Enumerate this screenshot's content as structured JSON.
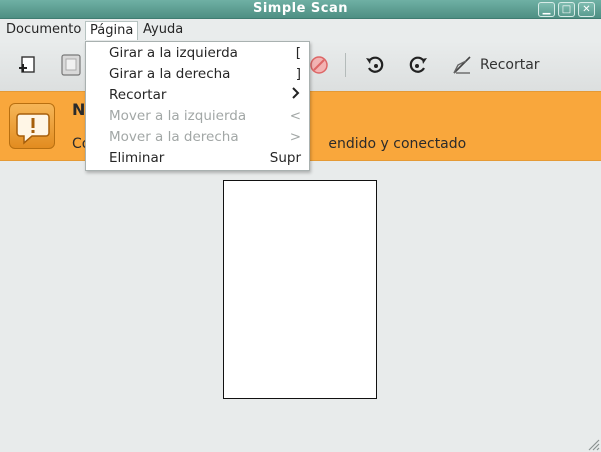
{
  "window": {
    "title": "Simple Scan"
  },
  "menubar": {
    "items": [
      "Documento",
      "Página",
      "Ayuda"
    ]
  },
  "toolbar": {
    "crop_label": "Recortar"
  },
  "infobar": {
    "title": "N                          ner",
    "text_start": "Co",
    "text_end": "endido y conectado"
  },
  "page_menu": {
    "items": [
      {
        "label": "Girar a la izquierda",
        "accel": "[",
        "enabled": true
      },
      {
        "label": "Girar a la derecha",
        "accel": "]",
        "enabled": true
      },
      {
        "label": "Recortar",
        "accel": "",
        "submenu": true,
        "enabled": true
      },
      {
        "label": "Mover a la izquierda",
        "accel": "<",
        "enabled": false
      },
      {
        "label": "Mover a la derecha",
        "accel": ">",
        "enabled": false
      },
      {
        "label": "Eliminar",
        "accel": "Supr",
        "enabled": true
      }
    ]
  },
  "icons": {
    "new_page": "new-page-icon",
    "scan": "scan-icon",
    "stop": "stop-icon",
    "rotate_left": "rotate-left-icon",
    "rotate_right": "rotate-right-icon",
    "crop": "crop-icon",
    "info": "info-icon",
    "submenu": "chevron-right-icon"
  },
  "colors": {
    "titlebar": "#5a9c90",
    "infobar": "#f9a73c"
  }
}
